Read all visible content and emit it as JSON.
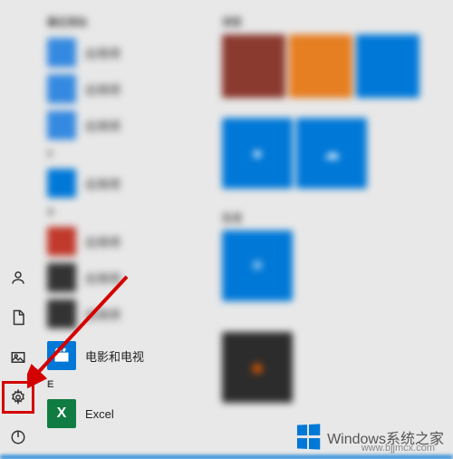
{
  "rail": {
    "user_icon": "user-icon",
    "documents_icon": "document-icon",
    "pictures_icon": "pictures-icon",
    "settings_icon": "gear-icon",
    "power_icon": "power-icon"
  },
  "app_list": {
    "sections": [
      {
        "header": "最近添加",
        "items": [
          {
            "label": "应用项",
            "color": "#3489e0"
          },
          {
            "label": "应用项",
            "color": "#3489e0"
          },
          {
            "label": "应用项",
            "color": "#3489e0"
          }
        ]
      },
      {
        "header": "#",
        "items": [
          {
            "label": "应用项",
            "color": "#0078d7"
          }
        ]
      },
      {
        "header": "A",
        "items": [
          {
            "label": "应用项",
            "color": "#c0392b"
          },
          {
            "label": "应用项",
            "color": "#333333"
          },
          {
            "label": "应用项",
            "color": "#333333"
          }
        ]
      }
    ],
    "clear_items": [
      {
        "label": "电影和电视",
        "color": "#0078d7",
        "icon": "clapper-icon"
      },
      {
        "header": "E"
      },
      {
        "label": "Excel",
        "color": "#107c41",
        "icon": "excel-icon"
      }
    ]
  },
  "tiles": {
    "groups": [
      {
        "label": "浏览",
        "rows": [
          [
            {
              "color": "#8b3a2f",
              "size": "sm"
            },
            {
              "color": "#e67e22",
              "size": "sm"
            },
            {
              "color": "#0078d7",
              "size": "sm"
            }
          ]
        ]
      },
      {
        "label": "",
        "rows": [
          [
            {
              "color": "#0078d7",
              "size": "md"
            },
            {
              "color": "#0078d7",
              "size": "md"
            }
          ]
        ]
      },
      {
        "label": "生活",
        "rows": [
          [
            {
              "color": "#0078d7",
              "size": "md"
            }
          ],
          [
            {
              "color": "#2c2c2c",
              "size": "md"
            }
          ]
        ]
      }
    ]
  },
  "watermark": {
    "text": "Windows系统之家",
    "url": "www.bjjmcx.com"
  }
}
